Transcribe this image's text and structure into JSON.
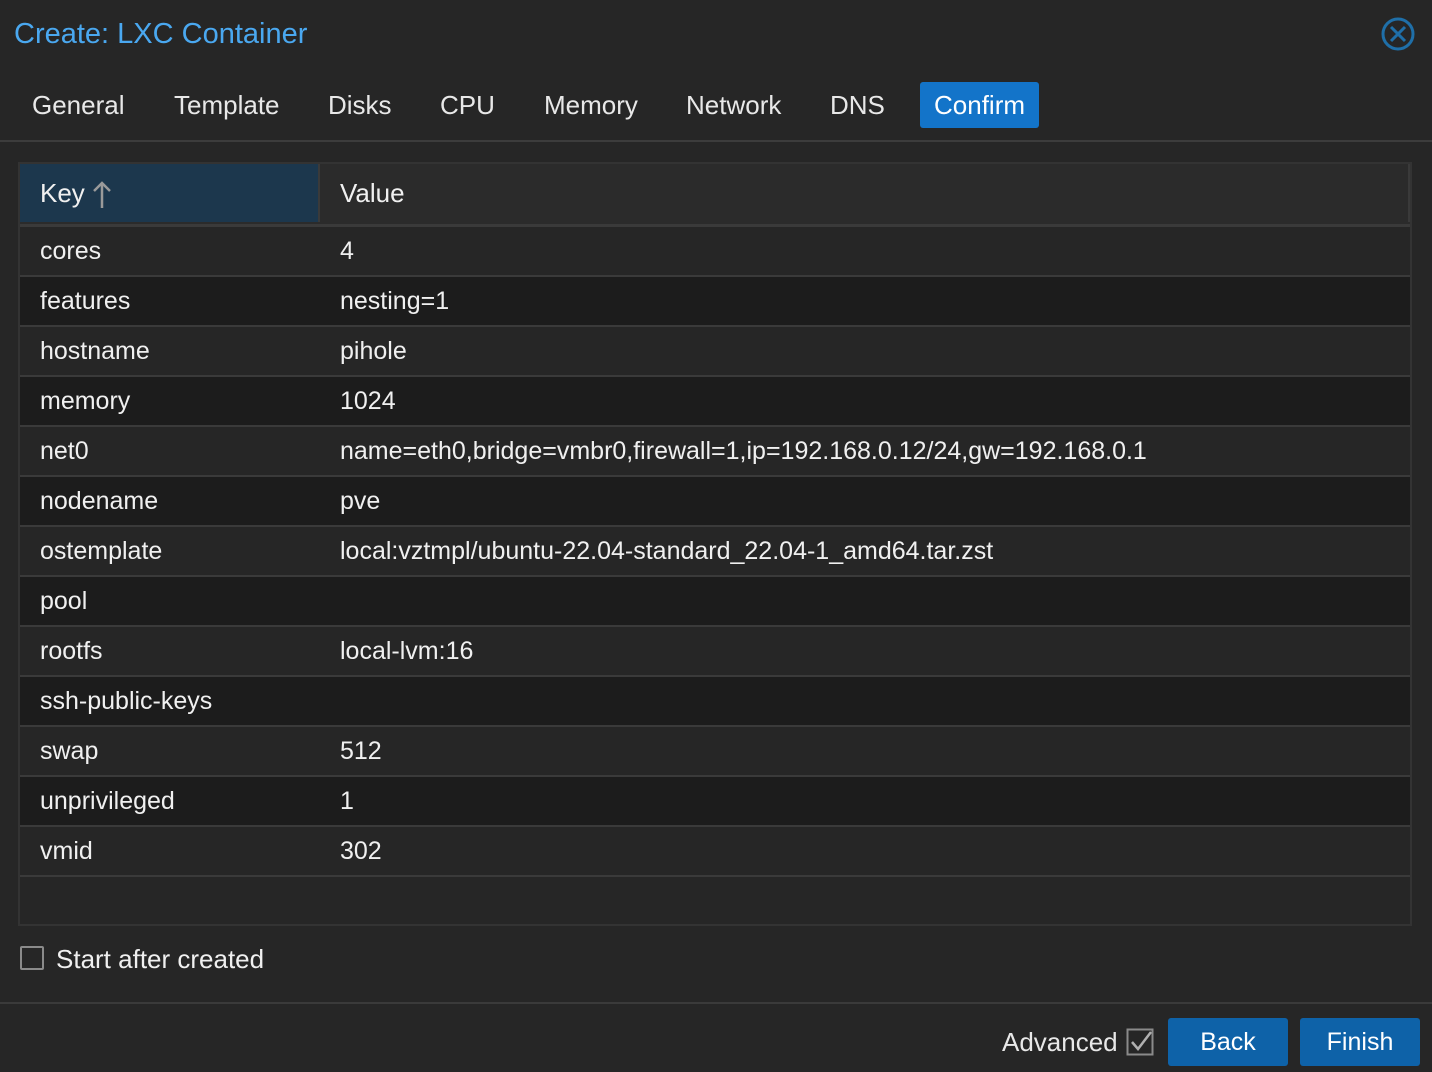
{
  "dialog": {
    "title": "Create: LXC Container"
  },
  "tabs": [
    {
      "label": "General"
    },
    {
      "label": "Template"
    },
    {
      "label": "Disks"
    },
    {
      "label": "CPU"
    },
    {
      "label": "Memory"
    },
    {
      "label": "Network"
    },
    {
      "label": "DNS"
    },
    {
      "label": "Confirm",
      "active": true
    }
  ],
  "grid": {
    "columns": {
      "key": "Key",
      "value": "Value"
    },
    "sort": "ascending",
    "rows": [
      {
        "key": "cores",
        "value": "4"
      },
      {
        "key": "features",
        "value": "nesting=1"
      },
      {
        "key": "hostname",
        "value": "pihole"
      },
      {
        "key": "memory",
        "value": "1024"
      },
      {
        "key": "net0",
        "value": "name=eth0,bridge=vmbr0,firewall=1,ip=192.168.0.12/24,gw=192.168.0.1"
      },
      {
        "key": "nodename",
        "value": "pve"
      },
      {
        "key": "ostemplate",
        "value": "local:vztmpl/ubuntu-22.04-standard_22.04-1_amd64.tar.zst"
      },
      {
        "key": "pool",
        "value": ""
      },
      {
        "key": "rootfs",
        "value": "local-lvm:16"
      },
      {
        "key": "ssh-public-keys",
        "value": ""
      },
      {
        "key": "swap",
        "value": "512"
      },
      {
        "key": "unprivileged",
        "value": "1"
      },
      {
        "key": "vmid",
        "value": "302"
      }
    ]
  },
  "start_after_created": {
    "label": "Start after created",
    "checked": false
  },
  "footer": {
    "advanced_label": "Advanced",
    "advanced_checked": true,
    "back_label": "Back",
    "finish_label": "Finish"
  },
  "colors": {
    "title": "#4aa8f0",
    "accent": "#1374c9",
    "button": "#0e62a8",
    "background": "#262626",
    "header_key_bg": "#1c374d"
  },
  "icons": {
    "close": "close-circle-icon",
    "sort": "sort-ascending-icon",
    "checkbox_empty": "checkbox-empty-icon",
    "checkbox_checked": "checkbox-checked-icon"
  }
}
